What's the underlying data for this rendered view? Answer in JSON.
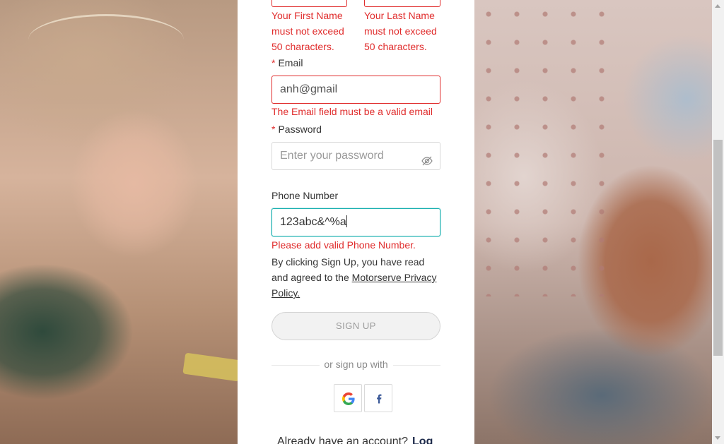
{
  "form": {
    "first_name_error": "Your First Name must not exceed 50 characters.",
    "last_name_error": "Your Last Name must not exceed 50 characters.",
    "email": {
      "required_mark": "*",
      "label": "Email",
      "value": "anh@gmail",
      "error": "The Email field must be a valid email"
    },
    "password": {
      "required_mark": "*",
      "label": "Password",
      "placeholder": "Enter your password"
    },
    "phone": {
      "label": "Phone Number",
      "value": "123abc&^%a",
      "error": "Please add valid Phone Number."
    },
    "terms": {
      "prefix": "By clicking Sign Up, you have read and agreed to the ",
      "link": "Motorserve Privacy Policy."
    },
    "signup_button": "SIGN UP",
    "or_text": "or sign up with",
    "social": [
      {
        "name": "google",
        "icon": "google-icon"
      },
      {
        "name": "facebook",
        "icon": "facebook-icon"
      }
    ],
    "footer": {
      "text": "Already have an account?",
      "login_link": "Log"
    }
  },
  "colors": {
    "error": "#e02c2c",
    "focus": "#1ab0b0",
    "link_dark": "#1d2a4a"
  }
}
